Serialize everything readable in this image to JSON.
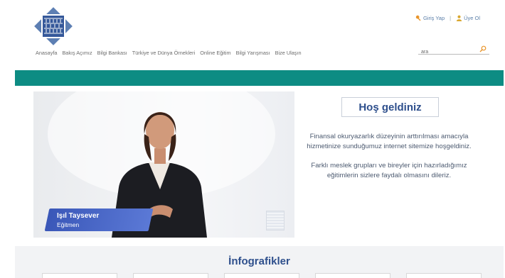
{
  "header": {
    "auth": {
      "login": "Giriş Yap",
      "separator": "|",
      "register": "Üye Ol"
    },
    "search": {
      "value": "ara"
    }
  },
  "nav": {
    "items": [
      "Anasayfa",
      "Bakış Açımız",
      "Bilgi Bankası",
      "Türkiye ve Dünya Örnekleri",
      "Online Eğitim",
      "Bilgi Yarışması",
      "Bize Ulaşın"
    ]
  },
  "hero": {
    "presenter_name": "Işıl Taysever",
    "presenter_role": "Eğitmen"
  },
  "welcome": {
    "title": "Hoş geldiniz",
    "paragraph1": "Finansal okuryazarlık düzeyinin arttırılması amacıyla hizmetinize sunduğumuz internet sitemize hoşgeldiniz.",
    "paragraph2": "Farklı meslek grupları ve bireyler için hazırladığımız eğitimlerin sizlere faydalı olmasını dileriz."
  },
  "infographics": {
    "title": "İnfografikler"
  },
  "colors": {
    "teal_bar": "#0d8c83",
    "title_blue": "#2e4f8c",
    "name_card": "#3a57b8",
    "login_icon": "#e9952b",
    "register_icon": "#d9a830"
  }
}
